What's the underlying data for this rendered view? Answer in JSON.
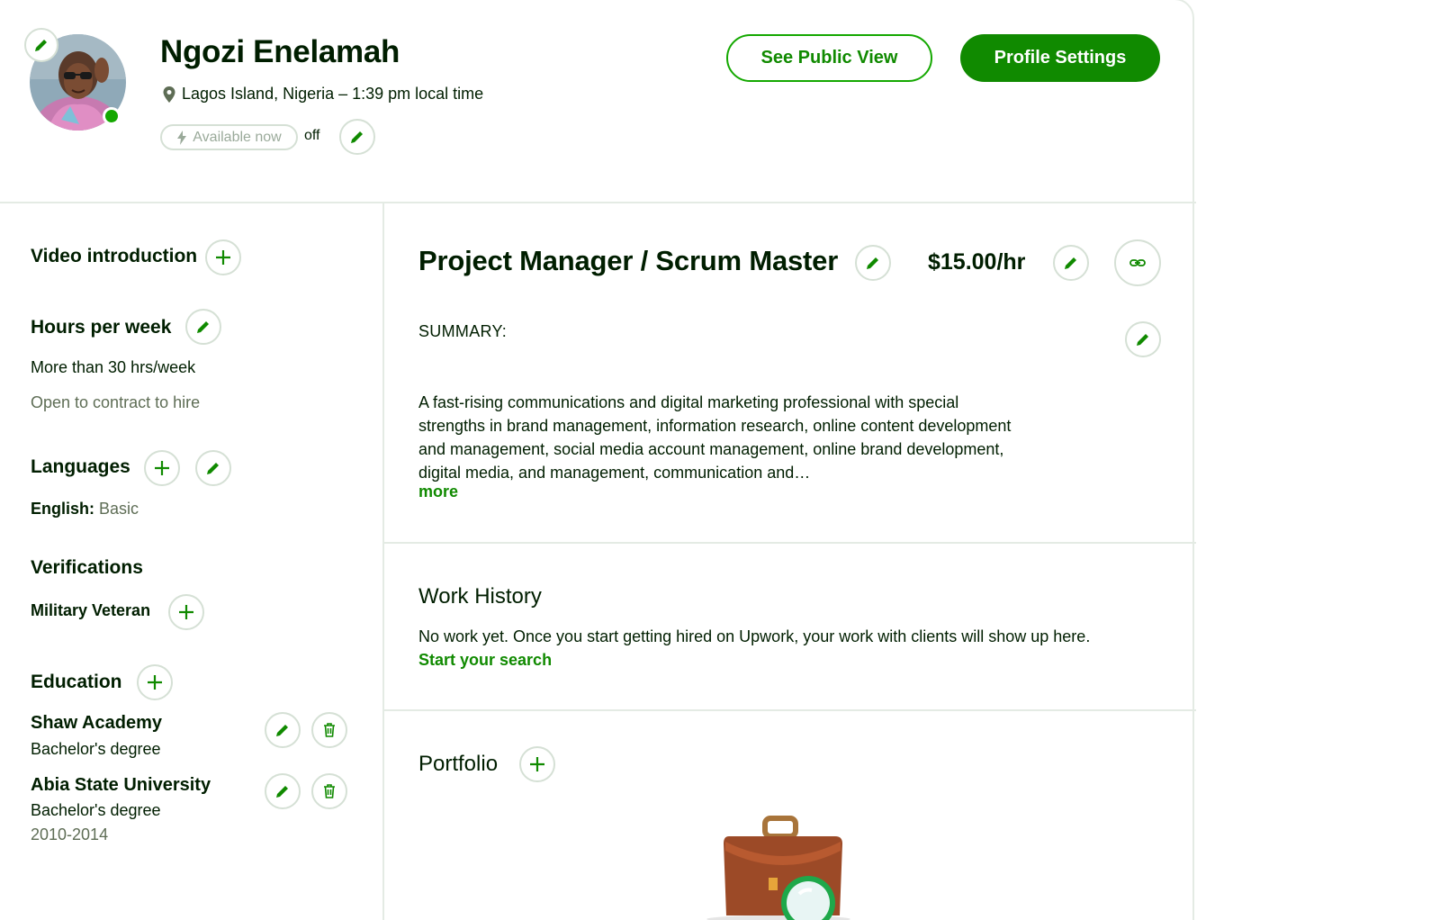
{
  "profile": {
    "name": "Ngozi Enelamah",
    "location": "Lagos Island, Nigeria – 1:39 pm local time",
    "availability_label": "Available now",
    "availability_state": "off",
    "online_color": "#14a800"
  },
  "header": {
    "public_view_label": "See Public View",
    "settings_label": "Profile Settings"
  },
  "sidebar": {
    "video_title": "Video introduction",
    "hours_title": "Hours per week",
    "hours_value": "More than 30 hrs/week",
    "hours_note": "Open to contract to hire",
    "languages_title": "Languages",
    "language_name": "English:",
    "language_level": "Basic",
    "verifications_title": "Verifications",
    "verification_item": "Military Veteran",
    "education_title": "Education",
    "education": [
      {
        "school": "Shaw Academy",
        "degree": "Bachelor's degree",
        "years": ""
      },
      {
        "school": "Abia State University",
        "degree": "Bachelor's degree",
        "years": "2010-2014"
      }
    ]
  },
  "main": {
    "title": "Project Manager / Scrum Master",
    "rate": "$15.00/hr",
    "summary_label": "SUMMARY:",
    "summary_text": "A fast-rising communications and digital marketing professional with special strengths in brand management, information research, online content development and management, social media account management, online brand development, digital media, and management, communication and…",
    "more_label": "more",
    "work_history_title": "Work History",
    "work_history_text": "No work yet. Once you start getting hired on Upwork, your work with clients will show up here.",
    "work_history_link": "Start your search",
    "portfolio_title": "Portfolio"
  },
  "icons": {
    "edit": "pencil-icon",
    "add": "plus-icon",
    "delete": "trash-icon",
    "link": "link-icon",
    "location": "map-pin-icon",
    "availability": "lightning-icon"
  },
  "colors": {
    "brand_green": "#108a00",
    "accent_green": "#14a800",
    "text": "#001e00",
    "muted": "#5e6d55",
    "border": "#e4ebe4"
  }
}
